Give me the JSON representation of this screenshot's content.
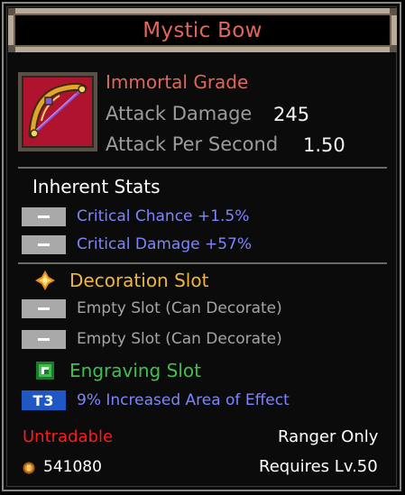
{
  "item": {
    "name": "Mystic Bow",
    "grade": "Immortal Grade",
    "icon": "bow-icon",
    "stats": [
      {
        "label": "Attack Damage",
        "value": "245"
      },
      {
        "label": "Attack Per Second",
        "value": "1.50"
      }
    ]
  },
  "inherent": {
    "heading": "Inherent Stats",
    "rows": [
      {
        "text": "Critical Chance +1.5%"
      },
      {
        "text": "Critical Damage +57%"
      }
    ]
  },
  "decoration": {
    "heading": "Decoration Slot",
    "icon": "diamond-gem-icon",
    "slots": [
      {
        "text": "Empty Slot (Can Decorate)"
      },
      {
        "text": "Empty Slot (Can Decorate)"
      }
    ]
  },
  "engraving": {
    "heading": "Engraving Slot",
    "icon": "green-rune-icon",
    "tier_badge": "T3",
    "text": "9% Increased Area of Effect"
  },
  "footer": {
    "tradable": "Untradable",
    "class_restriction": "Ranger Only",
    "price": "541080",
    "price_icon": "coin-icon",
    "level_req": "Requires Lv.50"
  },
  "colors": {
    "title": "#e2665a",
    "grade": "#e0675a",
    "stat_blue": "#7f84ff",
    "decoration_gold": "#f0b63a",
    "engraving_green": "#3fc04e",
    "untradable_red": "#ff1a1a",
    "tier_blue": "#1f58c2"
  }
}
